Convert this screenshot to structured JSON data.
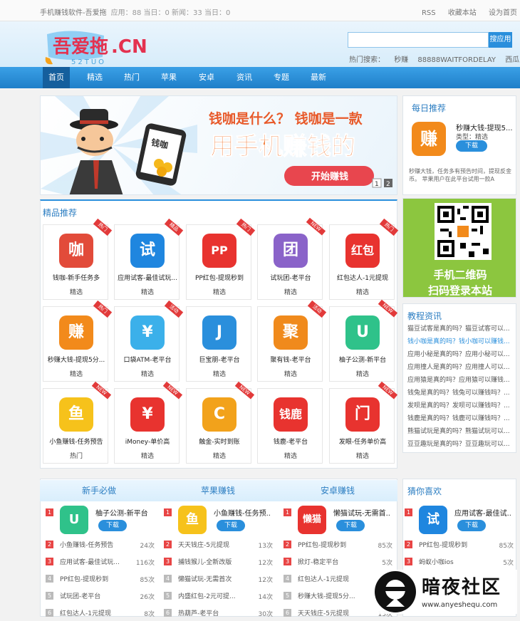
{
  "topbar": {
    "title": "手机赚钱软件-吾爱拖",
    "stats": "应用：88 当日：0 新闻：33 当日：0",
    "links": [
      "RSS",
      "收藏本站",
      "设为首页"
    ]
  },
  "logo": {
    "text": "吾爱拖",
    "cn": ".CN",
    "sub": "52TUO"
  },
  "search": {
    "placeholder": "",
    "button": "搜应用",
    "hot_label": "热门搜索：",
    "hot": [
      "秒赚",
      "88888WAITFORDELAY",
      "西瓜"
    ]
  },
  "nav": [
    "首页",
    "精选",
    "热门",
    "苹果",
    "安卓",
    "资讯",
    "专题",
    "最新"
  ],
  "banner": {
    "line1": "钱咖是什么？ 钱咖是一款",
    "line2": "用手机赚钱的",
    "button": "开始赚钱",
    "phone_text": "钱咖",
    "pages": [
      "1",
      "2"
    ]
  },
  "daily": {
    "title": "每日推荐",
    "app": "秒赚大钱-提现5...",
    "type": "类型：精选",
    "download": "下载",
    "desc": "秒赚大钱，任务多有预告时间，提现反金币。 苹果用户在此平台试用一款A",
    "icon_char": "赚",
    "tag": "热门"
  },
  "qr": {
    "line1": "手机二维码",
    "line2": "扫码登录本站"
  },
  "featured": {
    "title": "精品推荐",
    "apps": [
      {
        "name": "钱咖-新手任务多",
        "cat": "精选",
        "icon": "咖",
        "color": "#e24b3a",
        "tag": "热门"
      },
      {
        "name": "应用试客-最佳试玩...",
        "cat": "精选",
        "icon": "试",
        "color": "#1f86df",
        "tag": "精品"
      },
      {
        "name": "PP红包-提现秒到",
        "cat": "精选",
        "icon": "PP",
        "color": "#e8332f",
        "tag": "热门"
      },
      {
        "name": "试玩团-老平台",
        "cat": "精选",
        "icon": "团",
        "color": "#8a63c9",
        "tag": "NEW"
      },
      {
        "name": "红包达人-1元提现",
        "cat": "精选",
        "icon": "红包",
        "color": "#e8332f",
        "tag": "热门"
      },
      {
        "name": "秒赚大钱-提现5分...",
        "cat": "精选",
        "icon": "赚",
        "color": "#f28a1b",
        "tag": "热门"
      },
      {
        "name": "口袋ATM-老平台",
        "cat": "精选",
        "icon": "¥",
        "color": "#3bb0ea",
        "tag": "活动"
      },
      {
        "name": "巨宝朋-老平台",
        "cat": "精选",
        "icon": "J",
        "color": "#2a8fdc",
        "tag": ""
      },
      {
        "name": "聚有钱-老平台",
        "cat": "精选",
        "icon": "聚",
        "color": "#f08a1c",
        "tag": "活动"
      },
      {
        "name": "柚子公测-新平台",
        "cat": "精选",
        "icon": "U",
        "color": "#2fc28a",
        "tag": "NEW"
      },
      {
        "name": "小鱼赚钱-任务预告",
        "cat": "热门",
        "icon": "鱼",
        "color": "#f6c21b",
        "tag": "NEW"
      },
      {
        "name": "iMoney-单价高",
        "cat": "精选",
        "icon": "¥",
        "color": "#e8332f",
        "tag": "NEW"
      },
      {
        "name": "触金-实时到账",
        "cat": "精选",
        "icon": "C",
        "color": "#f2a21b",
        "tag": "NEW"
      },
      {
        "name": "钱鹿-老平台",
        "cat": "精选",
        "icon": "钱鹿",
        "color": "#e8332f",
        "tag": ""
      },
      {
        "name": "发眼-任务单价高",
        "cat": "精选",
        "icon": "门",
        "color": "#e8332f",
        "tag": "NEW"
      }
    ]
  },
  "tutorial": {
    "title": "教程资讯",
    "items": [
      "猫豆试客是真的吗？猫豆试客可以...",
      "钱小咖是真的吗？钱小咖可以赚钱...",
      "应用小秘是真的吗？应用小秘可以...",
      "应用撞人是真的吗？应用撞人可以...",
      "应用猿是真的吗？应用猿可以赚钱...",
      "钱兔是真的吗？钱兔可以赚钱吗？...",
      "发呗是真的吗？发呗可以赚钱吗？...",
      "钱鹿是真的吗？钱鹿可以赚钱吗？...",
      "熊猫试玩是真的吗？熊猫试玩可以...",
      "豆豆趣玩是真的吗？豆豆趣玩可以..."
    ]
  },
  "columns": [
    {
      "title": "新手必做",
      "top": {
        "name": "柚子公测-新平台",
        "icon": "U",
        "color": "#2fc28a"
      },
      "rows": [
        {
          "n": "2",
          "t": "小鱼赚钱-任务预告",
          "c": "24次"
        },
        {
          "n": "3",
          "t": "应用试客-最佳试玩...",
          "c": "116次"
        },
        {
          "n": "4",
          "t": "PP红包-提现秒到",
          "c": "85次"
        },
        {
          "n": "5",
          "t": "试玩团-老平台",
          "c": "26次"
        },
        {
          "n": "6",
          "t": "红包达人-1元提现",
          "c": "8次"
        }
      ]
    },
    {
      "title": "苹果赚钱",
      "top": {
        "name": "小鱼赚钱-任务预...",
        "icon": "鱼",
        "color": "#f6c21b"
      },
      "rows": [
        {
          "n": "2",
          "t": "天天钱庄-5元提现",
          "c": "13次"
        },
        {
          "n": "3",
          "t": "捕钱猴儿-全新改版",
          "c": "12次"
        },
        {
          "n": "4",
          "t": "懒猫试玩-无需首次",
          "c": "12次"
        },
        {
          "n": "5",
          "t": "内盛红包-2元可提...",
          "c": "14次"
        },
        {
          "n": "6",
          "t": "热葫芦-老平台",
          "c": "30次"
        }
      ]
    },
    {
      "title": "安卓赚钱",
      "top": {
        "name": "懒猫试玩-无需首...",
        "icon": "懒猫",
        "color": "#e8332f"
      },
      "rows": [
        {
          "n": "2",
          "t": "PP红包-提现秒到",
          "c": "85次"
        },
        {
          "n": "3",
          "t": "掀灯-稳定平台",
          "c": "5次"
        },
        {
          "n": "4",
          "t": "红包达人-1元提现",
          "c": "8次"
        },
        {
          "n": "5",
          "t": "秒赚大钱-提现5分...",
          "c": "63次"
        },
        {
          "n": "6",
          "t": "天天钱庄-5元提现",
          "c": "13次"
        }
      ]
    }
  ],
  "guess": {
    "title": "猜你喜欢",
    "top": {
      "name": "应用试客-最佳试...",
      "icon": "试",
      "color": "#1f86df"
    },
    "rows": [
      {
        "n": "2",
        "t": "PP红包-提现秒到",
        "c": "85次"
      },
      {
        "n": "3",
        "t": "蚂蚁小咖ios",
        "c": "5次"
      }
    ]
  },
  "download_label": "下载",
  "watermark": {
    "text": "暗夜社区",
    "url": "www.anyeshequ.com"
  }
}
